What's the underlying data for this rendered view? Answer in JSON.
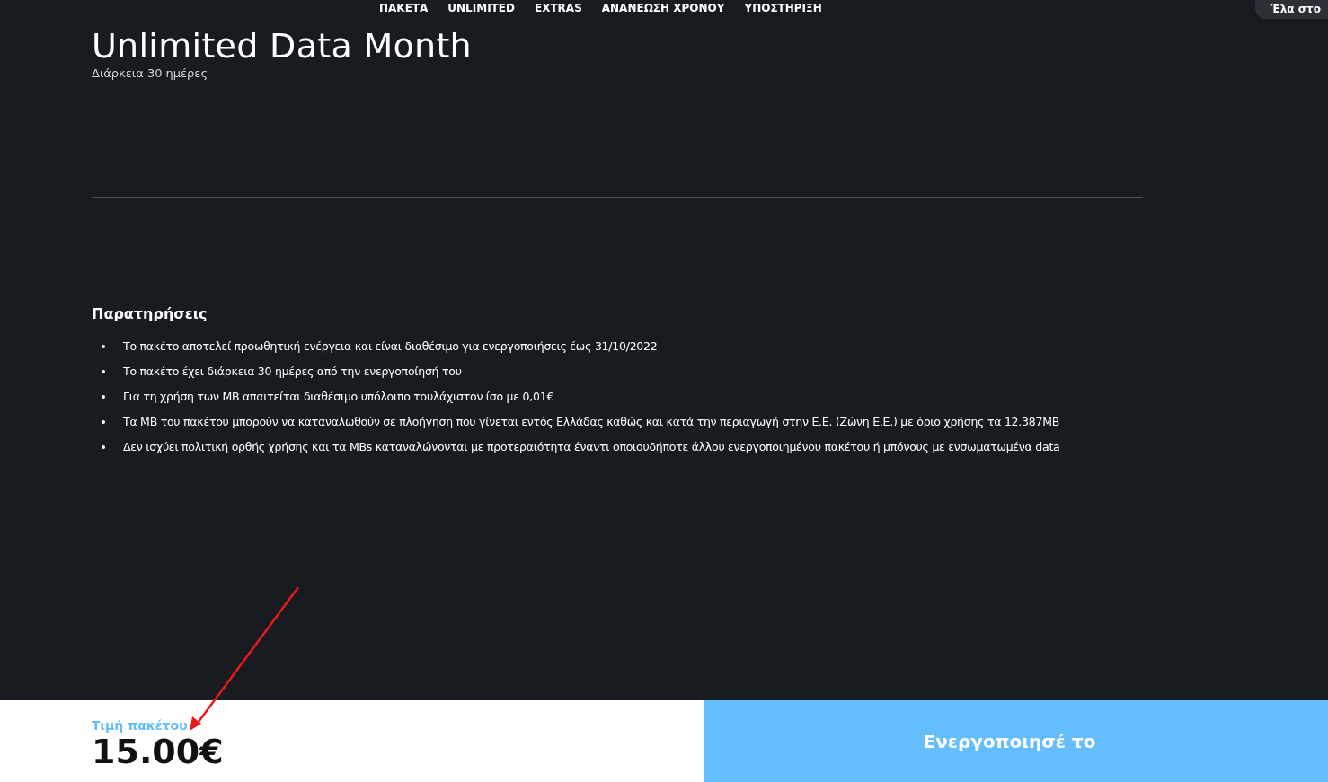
{
  "nav": {
    "items": [
      {
        "label": "ΠΑΚΕΤΑ"
      },
      {
        "label": "UNLIMITED"
      },
      {
        "label": "EXTRAS"
      },
      {
        "label": "ΑΝΑΝΕΩΣΗ ΧΡΟΝΟΥ"
      },
      {
        "label": "ΥΠΟΣΤΗΡΙΞΗ"
      }
    ],
    "cta": "Έλα στο"
  },
  "package": {
    "title": "Unlimited Data Month",
    "duration": "Διάρκεια 30 ημέρες"
  },
  "notes": {
    "heading": "Παρατηρήσεις",
    "items": [
      "Το πακέτο αποτελεί προωθητική ενέργεια και είναι διαθέσιμο για ενεργοποιήσεις έως 31/10/2022",
      "Το πακέτο έχει διάρκεια 30 ημέρες από την ενεργοποίησή του",
      "Για τη χρήση των MB απαιτείται διαθέσιμο υπόλοιπο τουλάχιστον ίσο με 0,01€",
      "Τα MB του πακέτου μπορούν να καταναλωθούν σε πλοήγηση που γίνεται εντός Ελλάδας καθώς και κατά την περιαγωγή στην Ε.Ε. (Ζώνη Ε.Ε.) με όριο χρήσης τα 12.387MB",
      "Δεν ισχύει πολιτική ορθής χρήσης και τα MBs καταναλώνονται με προτεραιότητα έναντι οποιουδήποτε άλλου ενεργοποιημένου πακέτου ή μπόνους με ενσωματωμένα data"
    ]
  },
  "footer": {
    "price_label": "Τιμή πακέτου",
    "price": "15.00€",
    "button": "Ενεργοποιησέ το"
  }
}
